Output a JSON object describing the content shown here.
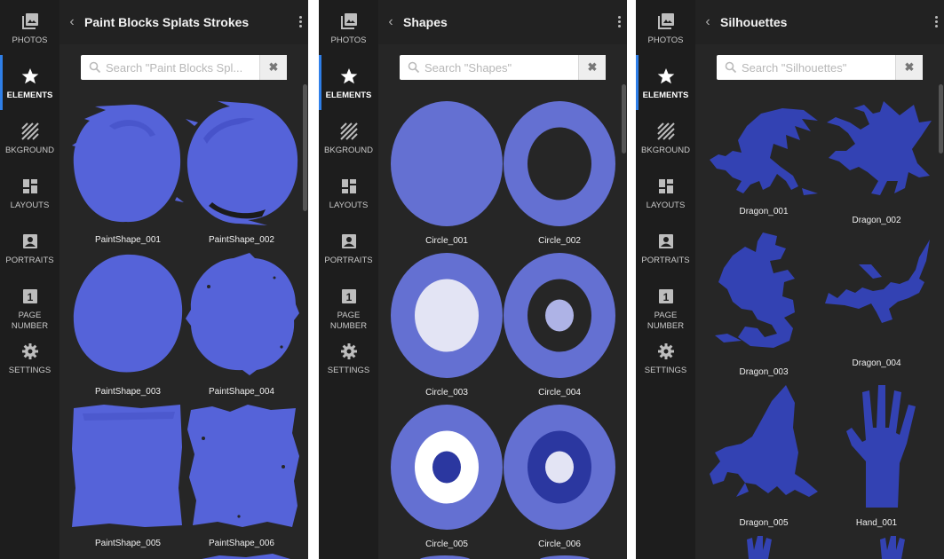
{
  "sidebar": {
    "items": [
      {
        "label": "PHOTOS",
        "icon": "photos-icon"
      },
      {
        "label": "ELEMENTS",
        "icon": "star-icon"
      },
      {
        "label": "BKGROUND",
        "icon": "background-icon"
      },
      {
        "label": "LAYOUTS",
        "icon": "layouts-icon"
      },
      {
        "label": "PORTRAITS",
        "icon": "portrait-icon"
      },
      {
        "label": "PAGE",
        "label2": "NUMBER",
        "icon": "page-number-icon",
        "badge": "1"
      },
      {
        "label": "SETTINGS",
        "icon": "gear-icon"
      }
    ],
    "active_index": 1,
    "accent": "#2f7fe8"
  },
  "panels": [
    {
      "title": "Paint Blocks Splats Strokes",
      "search_placeholder": "Search \"Paint Blocks Spl...",
      "items": [
        "PaintShape_001",
        "PaintShape_002",
        "PaintShape_003",
        "PaintShape_004",
        "PaintShape_005",
        "PaintShape_006"
      ]
    },
    {
      "title": "Shapes",
      "search_placeholder": "Search \"Shapes\"",
      "items": [
        "Circle_001",
        "Circle_002",
        "Circle_003",
        "Circle_004",
        "Circle_005",
        "Circle_006"
      ]
    },
    {
      "title": "Silhouettes",
      "search_placeholder": "Search \"Silhouettes\"",
      "items": [
        "Dragon_001",
        "Dragon_002",
        "Dragon_003",
        "Dragon_004",
        "Dragon_005",
        "Hand_001"
      ]
    }
  ],
  "colors": {
    "paint": "#5563d9",
    "shape": "#6470d2",
    "shape_light": "#e3e4f4",
    "shape_dark": "#2b37a0",
    "silhouette": "#3342b3"
  }
}
